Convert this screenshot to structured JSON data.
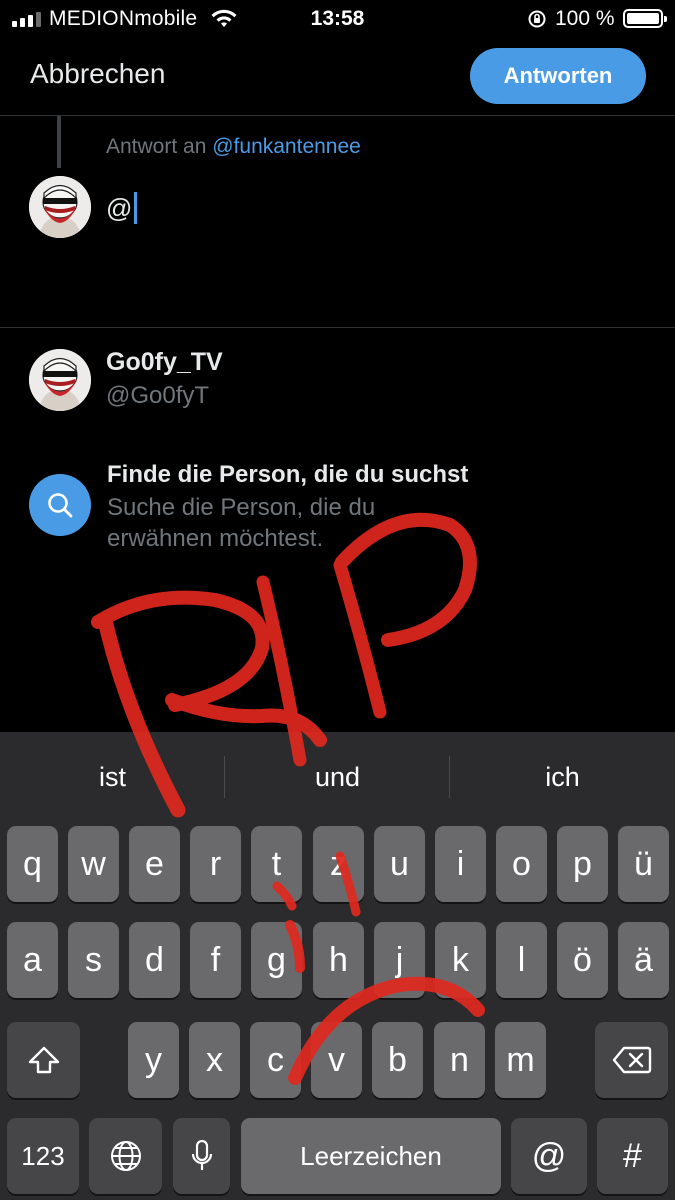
{
  "status_bar": {
    "carrier": "MEDIONmobile",
    "time": "13:58",
    "battery": "100 %"
  },
  "header": {
    "cancel_label": "Abbrechen",
    "reply_label": "Antworten"
  },
  "compose": {
    "reply_prefix": "Antwort an",
    "reply_handle": "@funkantennee",
    "text": "@"
  },
  "suggestion": {
    "name": "Go0fy_TV",
    "handle": "@Go0fyT"
  },
  "find_person": {
    "title": "Finde die Person, die du suchst",
    "description": "Suche die Person, die du erwähnen möchtest."
  },
  "keyboard": {
    "predictions": [
      "ist",
      "und",
      "ich"
    ],
    "row1": [
      "q",
      "w",
      "e",
      "r",
      "t",
      "z",
      "u",
      "i",
      "o",
      "p",
      "ü"
    ],
    "row2": [
      "a",
      "s",
      "d",
      "f",
      "g",
      "h",
      "j",
      "k",
      "l",
      "ö",
      "ä"
    ],
    "row3": [
      "y",
      "x",
      "c",
      "v",
      "b",
      "n",
      "m"
    ],
    "numbers_label": "123",
    "space_label": "Leerzeichen",
    "at_label": "@",
    "hash_label": "#"
  },
  "colors": {
    "accent": "#4a9be6",
    "drawing": "#e0281e"
  }
}
